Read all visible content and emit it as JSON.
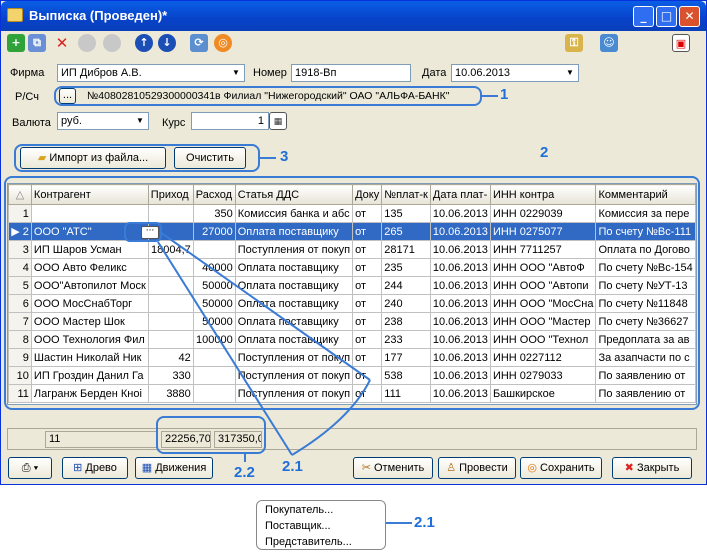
{
  "window": {
    "title": "Выписка (Проведен)*",
    "min": "_",
    "max": "□",
    "close": "✕"
  },
  "form": {
    "firm_label": "Фирма",
    "firm_value": "ИП Дибров А.В.",
    "number_label": "Номер",
    "number_value": "1918-Вп",
    "date_label": "Дата",
    "date_value": "10.06.2013",
    "account_label": "Р/Сч",
    "account_btn": "...",
    "account_value": "№40802810529300000341в Филиал \"Нижегородский\" ОАО \"АЛЬФА-БАНК\"",
    "currency_label": "Валюта",
    "currency_value": "руб.",
    "rate_label": "Курс",
    "rate_value": "1"
  },
  "buttons": {
    "import": "Импорт из файла...",
    "clear": "Очистить"
  },
  "table": {
    "headers": [
      "",
      "Контрагент",
      "Приход",
      "Расход",
      "Статья ДДС",
      "Доку",
      "№плат-к",
      "Дата плат-",
      "ИНН контра",
      "Комментарий"
    ],
    "rows": [
      [
        "1",
        "",
        "",
        "350",
        "Комиссия банка и абс",
        "от",
        "135",
        "10.06.2013",
        "ИНН 0229039",
        "Комиссия за пере"
      ],
      [
        "2",
        "ООО \"АТС\"",
        "",
        "27000",
        "Оплата поставщику",
        "от",
        "265",
        "10.06.2013",
        "ИНН 0275077",
        "По счету №Вс-111"
      ],
      [
        "3",
        "ИП Шаров Усман",
        "18004,7",
        "",
        "Поступления от покуп",
        "от",
        "28171",
        "10.06.2013",
        "ИНН 7711257",
        "Оплата по Догово"
      ],
      [
        "4",
        "ООО Авто Феликс",
        "",
        "40000",
        "Оплата поставщику",
        "от",
        "235",
        "10.06.2013",
        "ИНН ООО \"АвтоФ",
        "По счету №Вс-154"
      ],
      [
        "5",
        "ООО\"Автопилот Моск",
        "",
        "50000",
        "Оплата поставщику",
        "от",
        "244",
        "10.06.2013",
        "ИНН ООО \"Автопи",
        "По счету №УТ-13"
      ],
      [
        "6",
        "ООО МосСнабТорг",
        "",
        "50000",
        "Оплата поставщику",
        "от",
        "240",
        "10.06.2013",
        "ИНН ООО \"МосСна",
        "По счету №11848"
      ],
      [
        "7",
        "ООО Мастер Шок",
        "",
        "50000",
        "Оплата поставщику",
        "от",
        "238",
        "10.06.2013",
        "ИНН ООО \"Мастер",
        "По счету №36627"
      ],
      [
        "8",
        "ООО Технология Фил",
        "",
        "100000",
        "Оплата поставщику",
        "от",
        "233",
        "10.06.2013",
        "ИНН ООО \"Технол",
        "Предоплата за ав"
      ],
      [
        "9",
        "Шастин Николай Ник",
        "42",
        "",
        "Поступления от покуп",
        "от",
        "177",
        "10.06.2013",
        "ИНН 0227112",
        "За азапчасти по с"
      ],
      [
        "10",
        "ИП Гроздин Данил Га",
        "330",
        "",
        "Поступления от покуп",
        "от",
        "538",
        "10.06.2013",
        "ИНН 0279033",
        "По заявлению от"
      ],
      [
        "11",
        "Лагранж Берден Кноі",
        "3880",
        "",
        "Поступления от покуп",
        "от",
        "111",
        "10.06.2013",
        "Башкирское",
        "По заявлению от"
      ]
    ],
    "selected_row": 1
  },
  "footer": {
    "count": "11",
    "income_total": "22256,70",
    "expense_total": "317350,0"
  },
  "bottom": {
    "tree": "Древо",
    "movements": "Движения",
    "cancel": "Отменить",
    "post": "Провести",
    "save": "Сохранить",
    "close": "Закрыть"
  },
  "callouts": {
    "c1": "1",
    "c2": "2",
    "c3": "3",
    "c21": "2.1",
    "c22": "2.2",
    "c21b": "2.1"
  },
  "popup": {
    "items": [
      "Покупатель...",
      "Поставщик...",
      "Представитель..."
    ]
  },
  "colors": {
    "accent": "#3a7bd5",
    "selection": "#316ac5",
    "titlebar": "#0a5fe6"
  }
}
